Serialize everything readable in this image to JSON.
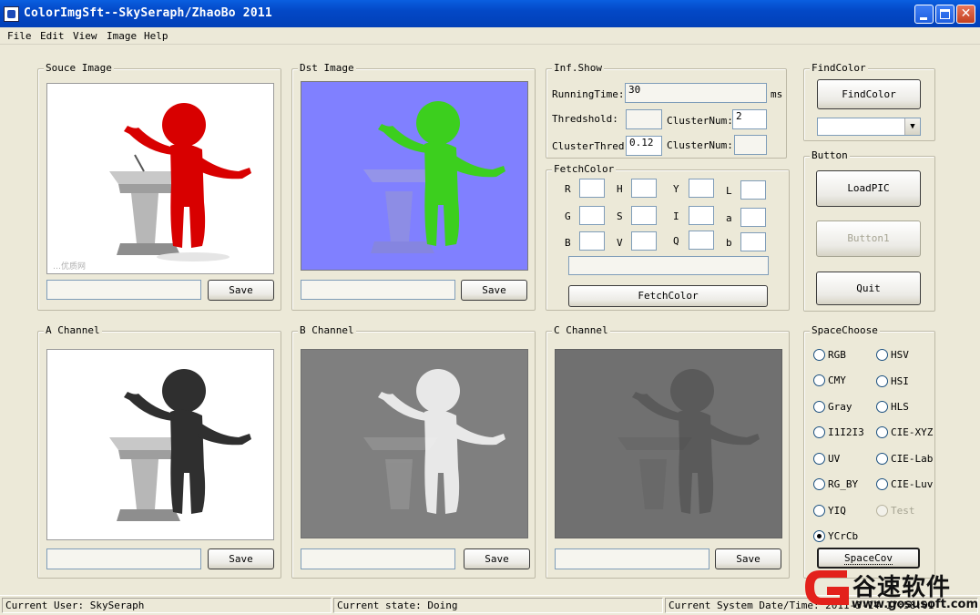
{
  "window": {
    "title": "ColorImgSft--SkySeraph/ZhaoBo 2011"
  },
  "menu": [
    "File",
    "Edit",
    "View",
    "Image",
    "Help"
  ],
  "panels": {
    "source": {
      "label": "Souce Image",
      "save": "Save",
      "watermark": "…优质网"
    },
    "dst": {
      "label": "Dst Image",
      "save": "Save"
    },
    "a_channel": {
      "label": "A Channel",
      "save": "Save"
    },
    "b_channel": {
      "label": "B Channel",
      "save": "Save"
    },
    "c_channel": {
      "label": "C Channel",
      "save": "Save"
    }
  },
  "inf_show": {
    "label": "Inf.Show",
    "running_time_label": "RunningTime:",
    "running_time_value": "30",
    "running_time_unit": "ms",
    "threshold_label": "Thredshold:",
    "cluster_num_label": "ClusterNum:",
    "cluster_num_value": "2",
    "cluster_thred_label": "ClusterThred:",
    "cluster_thred_value": "0.12",
    "cluster_num2_label": "ClusterNum:"
  },
  "fetch_color": {
    "label": "FetchColor",
    "rows": [
      [
        "R",
        "H",
        "Y",
        "L"
      ],
      [
        "G",
        "S",
        "I",
        "a"
      ],
      [
        "B",
        "V",
        "Q",
        "b"
      ]
    ],
    "button": "FetchColor"
  },
  "find_color": {
    "label": "FindColor",
    "button": "FindColor"
  },
  "button_group": {
    "label": "Button",
    "load": "LoadPIC",
    "button1": "Button1",
    "quit": "Quit"
  },
  "space_choose": {
    "label": "SpaceChoose",
    "options_left": [
      "RGB",
      "CMY",
      "Gray",
      "I1I2I3",
      "UV",
      "RG_BY",
      "YIQ",
      "YCrCb"
    ],
    "options_right": [
      "HSV",
      "HSI",
      "HLS",
      "CIE-XYZ",
      "CIE-Lab",
      "CIE-Luv",
      "Test"
    ],
    "selected": "YCrCb",
    "button": "SpaceCov"
  },
  "status": {
    "user": "Current User:  SkySeraph",
    "state": "Current state:  Doing",
    "datetime": "Current System Date/Time:  2011-3-14 17:58:01"
  },
  "watermark": {
    "text": "谷速软件",
    "url": "www.gosusoft.com"
  },
  "colors": {
    "titlebar": "#0348c6",
    "dst_bg": "#8080ff",
    "figure_red": "#d80000",
    "figure_green": "#3ccf1e",
    "channel_b_bg": "#7f7f7f",
    "channel_c_bg": "#6f6f6f"
  }
}
